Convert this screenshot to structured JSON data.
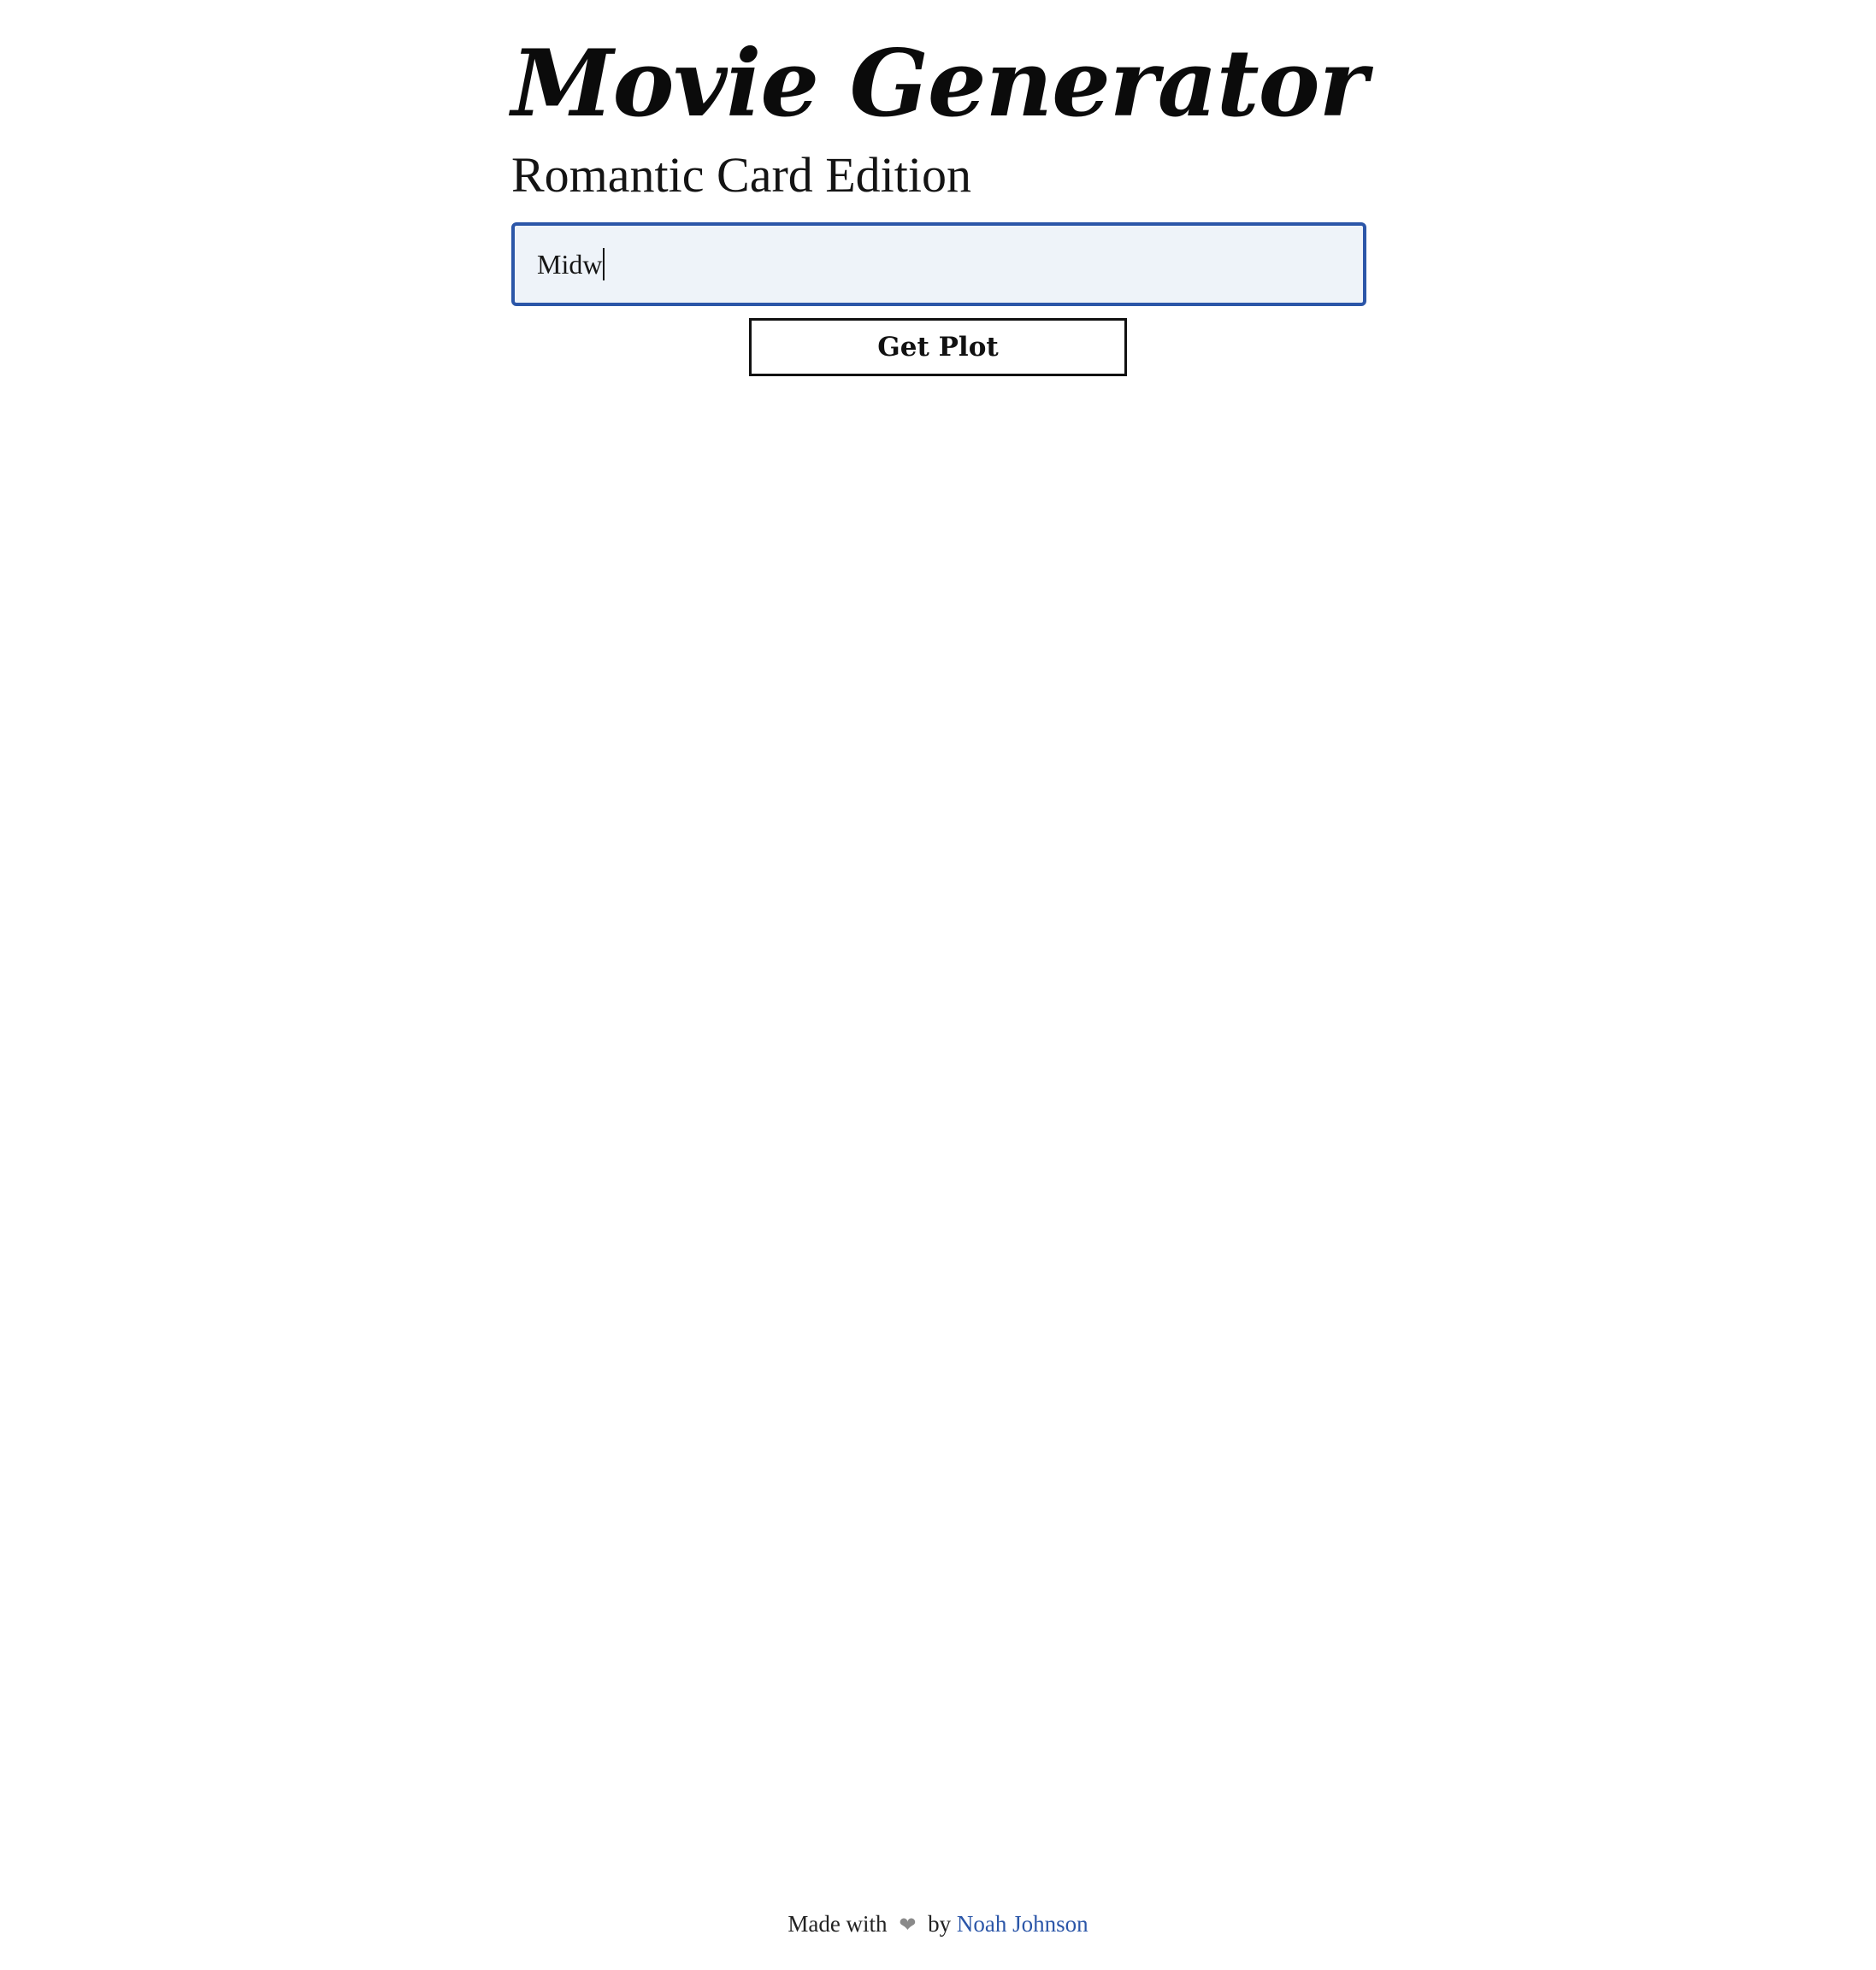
{
  "header": {
    "title": "Movie Generator",
    "subtitle": "Romantic Card Edition"
  },
  "form": {
    "input_value": "Midw",
    "submit_label": "Get Plot"
  },
  "footer": {
    "prefix": "Made with",
    "heart_icon": "heart-icon",
    "by": "by",
    "author_name": "Noah Johnson"
  },
  "colors": {
    "accent": "#2b56a8",
    "input_background": "#eef3f9",
    "text": "#111111",
    "heart": "#8a8a8a"
  }
}
